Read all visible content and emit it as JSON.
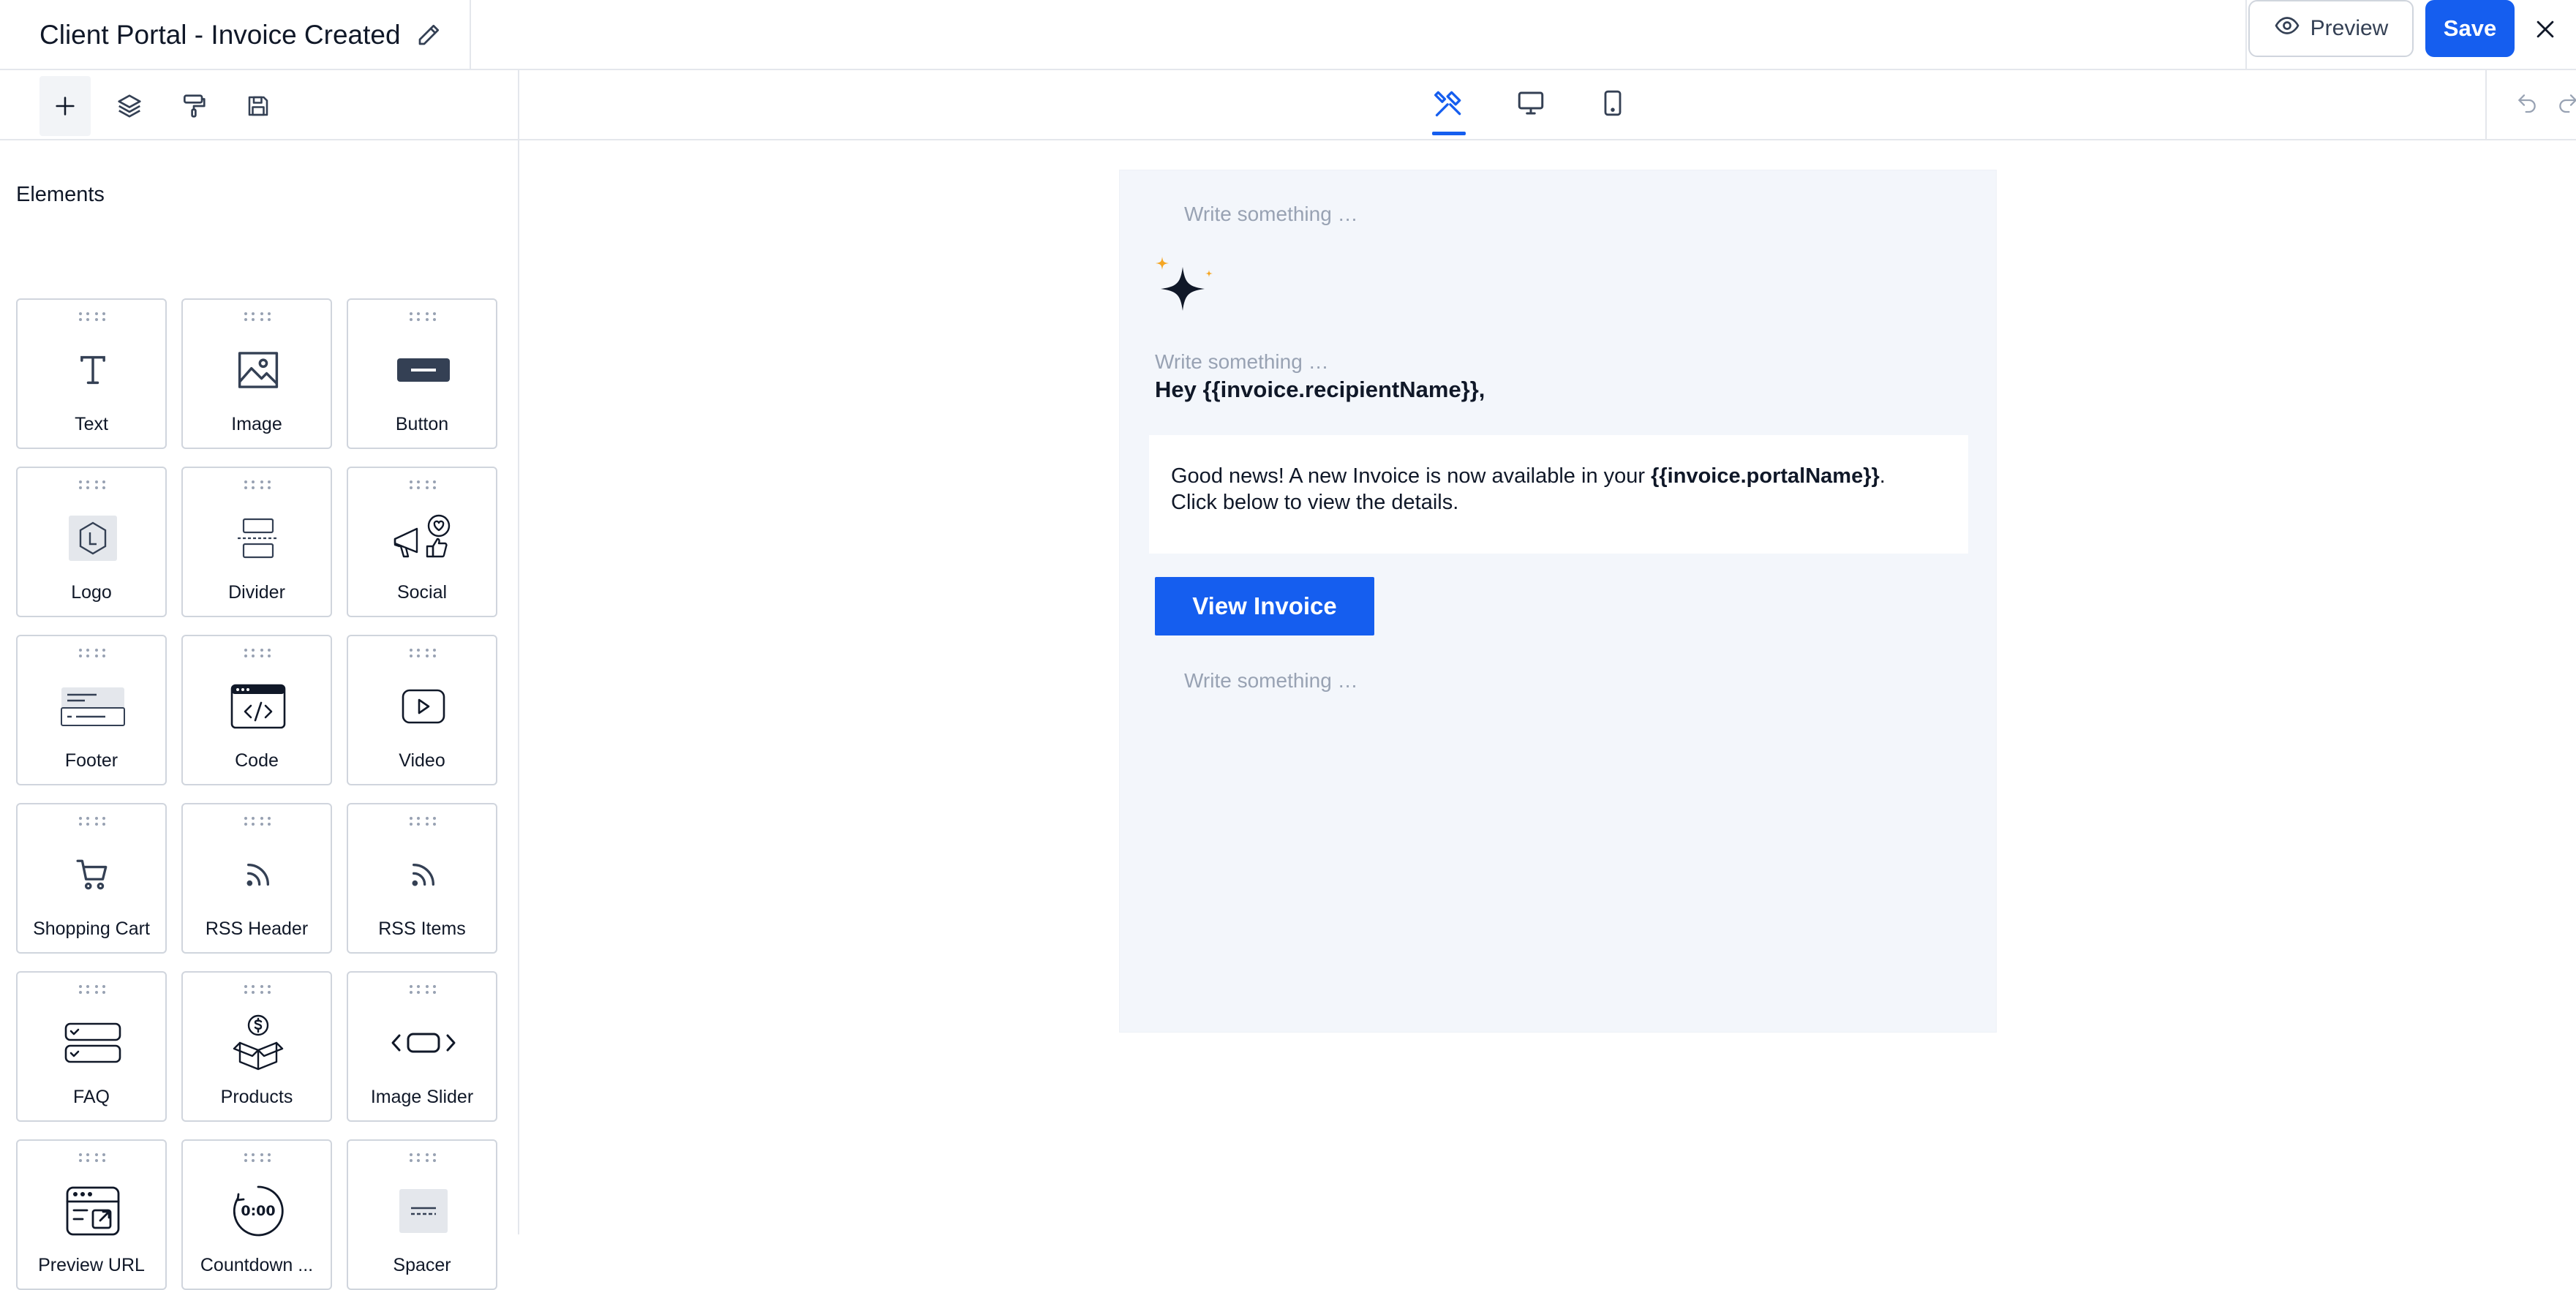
{
  "header": {
    "title": "Client Portal - Invoice Created",
    "preview_label": "Preview",
    "save_label": "Save"
  },
  "sidebar": {
    "heading": "Elements",
    "tools": [
      "add-icon",
      "layers-icon",
      "paint-roller-icon",
      "save-disk-icon"
    ],
    "elements": [
      {
        "label": "Text",
        "icon": "text-icon"
      },
      {
        "label": "Image",
        "icon": "image-icon"
      },
      {
        "label": "Button",
        "icon": "button-icon"
      },
      {
        "label": "Logo",
        "icon": "logo-icon"
      },
      {
        "label": "Divider",
        "icon": "divider-icon"
      },
      {
        "label": "Social",
        "icon": "social-icon"
      },
      {
        "label": "Footer",
        "icon": "footer-icon"
      },
      {
        "label": "Code",
        "icon": "code-icon"
      },
      {
        "label": "Video",
        "icon": "video-icon"
      },
      {
        "label": "Shopping Cart",
        "icon": "shopping-cart-icon"
      },
      {
        "label": "RSS Header",
        "icon": "rss-header-icon"
      },
      {
        "label": "RSS Items",
        "icon": "rss-items-icon"
      },
      {
        "label": "FAQ",
        "icon": "faq-icon"
      },
      {
        "label": "Products",
        "icon": "products-icon"
      },
      {
        "label": "Image Slider",
        "icon": "image-slider-icon"
      },
      {
        "label": "Preview URL",
        "icon": "preview-url-icon"
      },
      {
        "label": "Countdown ...",
        "icon": "countdown-icon"
      },
      {
        "label": "Spacer",
        "icon": "spacer-icon"
      }
    ]
  },
  "canvas": {
    "views": [
      "design-tools-icon",
      "desktop-icon",
      "mobile-icon"
    ],
    "active_view": "design-tools-icon"
  },
  "email": {
    "placeholder_top": "Write something …",
    "placeholder_mid": "Write something …",
    "greeting": "Hey {{invoice.recipientName}},",
    "body_pre": "Good news! A new Invoice is now available in your ",
    "body_var": "{{invoice.portalName}}",
    "body_post": ".",
    "body_line2": "Click below to view the details.",
    "cta_label": "View Invoice",
    "placeholder_bottom": "Write something …"
  },
  "colors": {
    "accent": "#155eef",
    "canvas_bg": "#f3f6fb",
    "border": "#d0d5dd",
    "placeholder": "#98a2b3",
    "sparkle_gold": "#f5a623"
  }
}
